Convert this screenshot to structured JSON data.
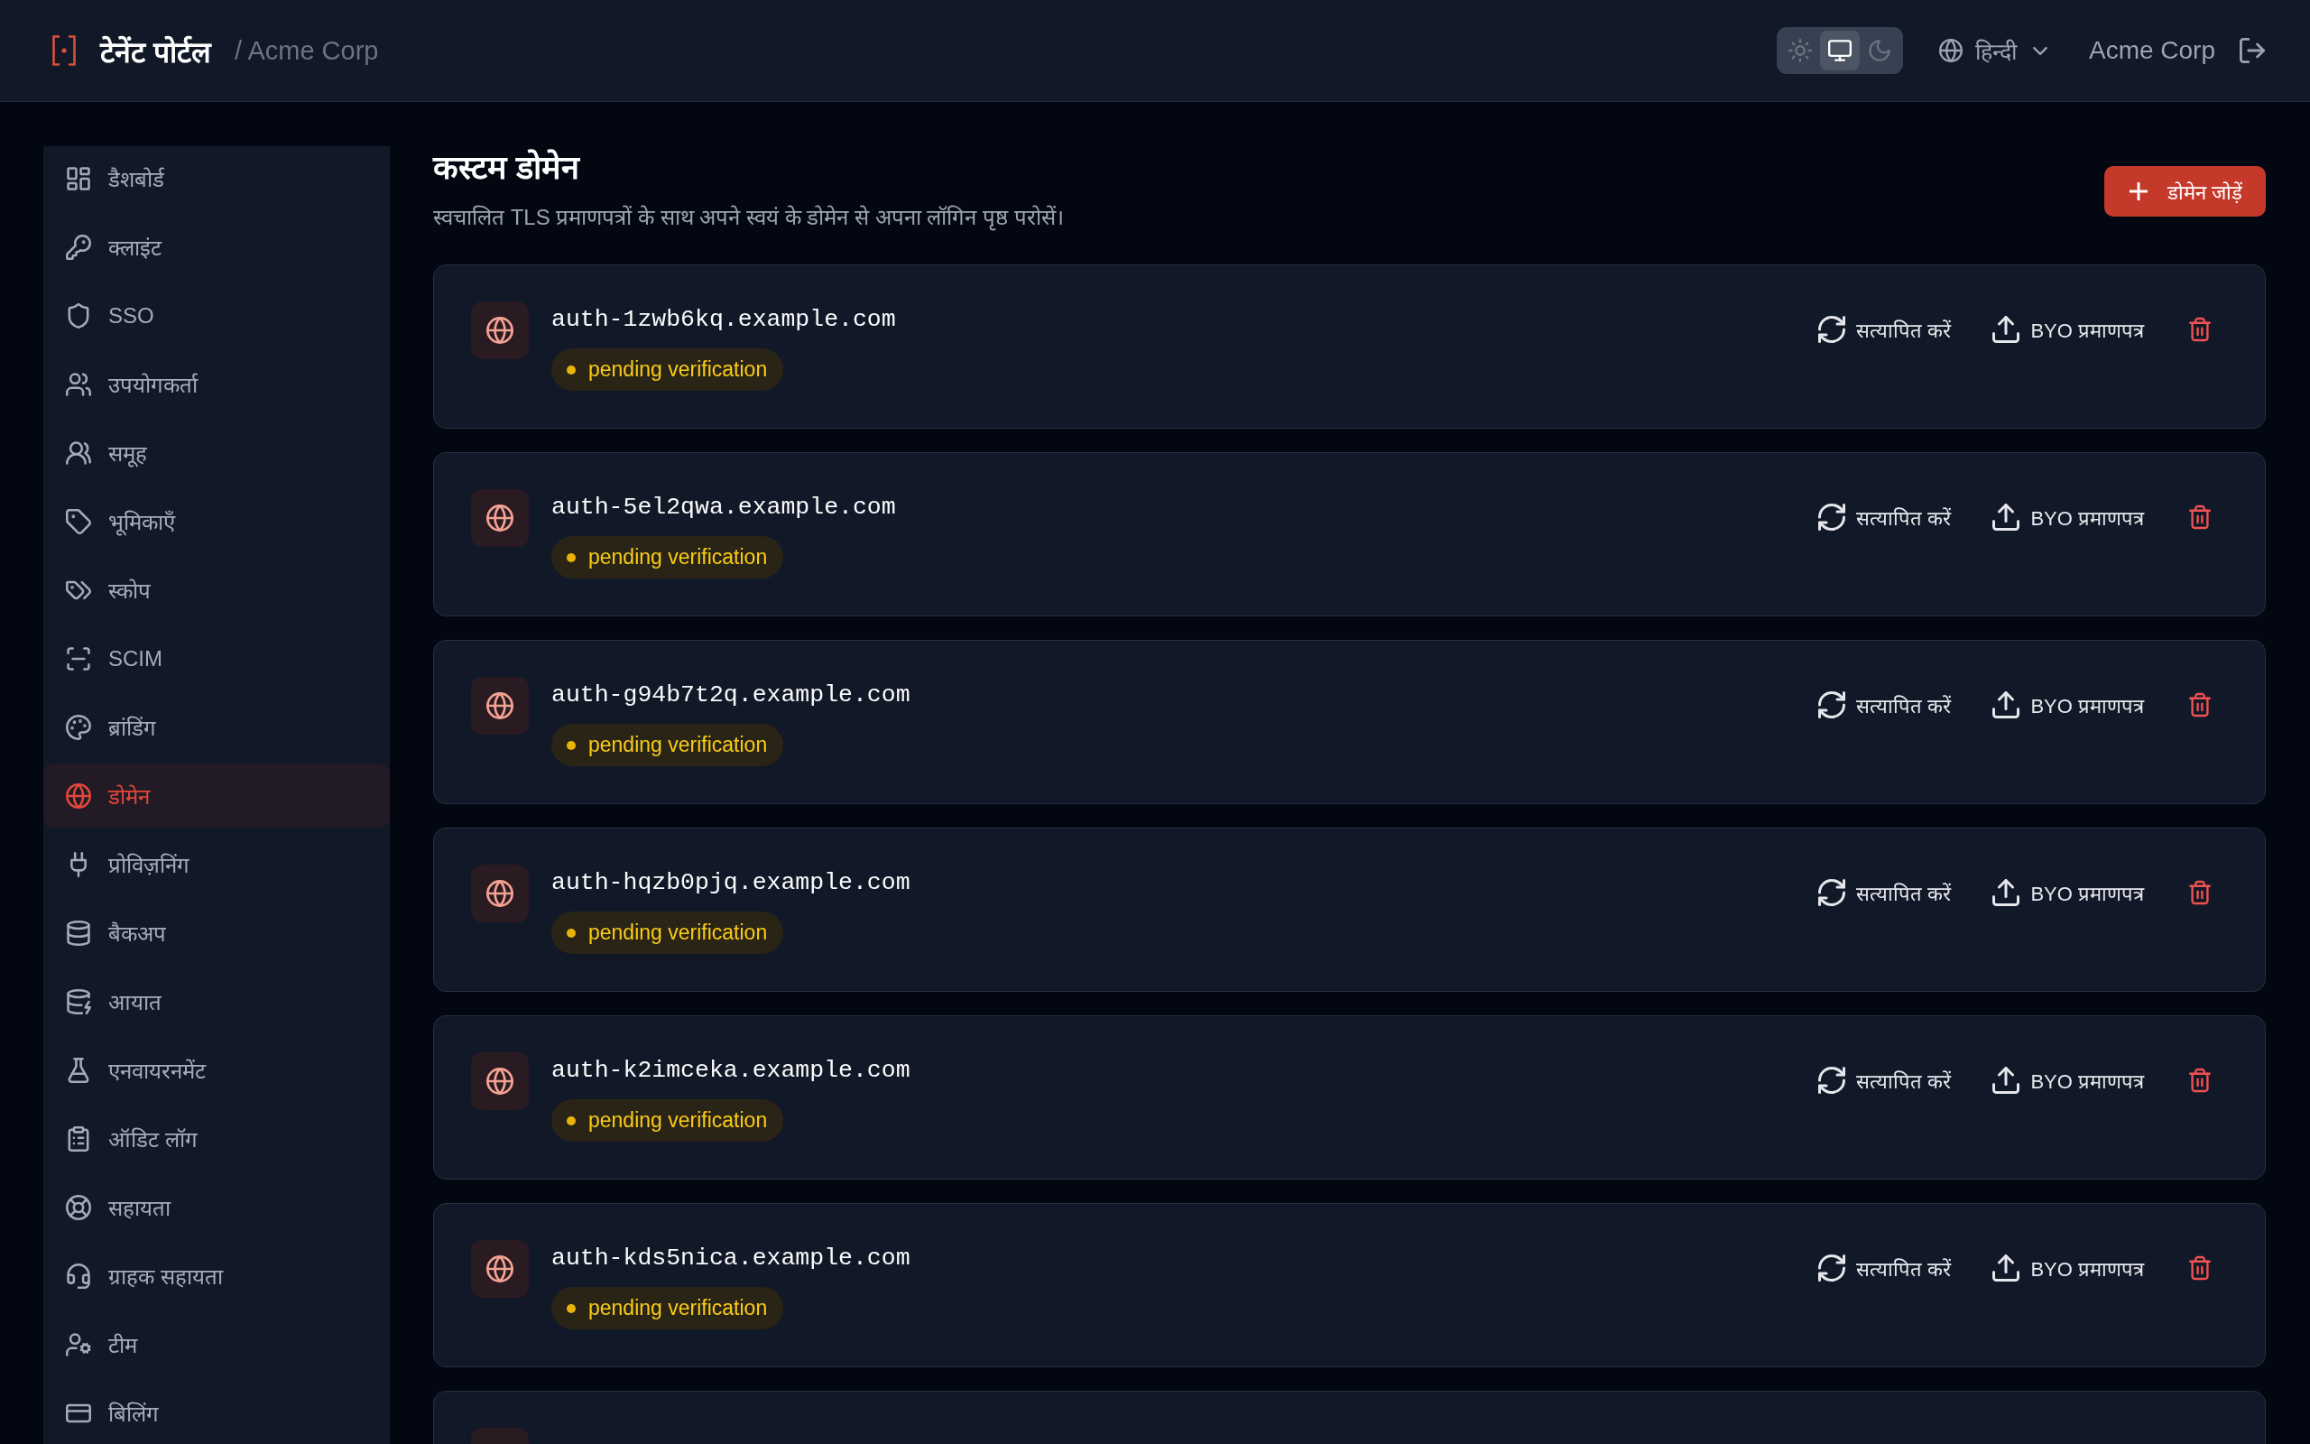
{
  "header": {
    "brand": "टेनेंट पोर्टल",
    "breadcrumb": "/ Acme Corp",
    "theme_options": [
      {
        "selected": false
      },
      {
        "selected": true
      },
      {
        "selected": false
      }
    ],
    "language": "हिन्दी",
    "account": "Acme Corp"
  },
  "sidebar": {
    "items": [
      {
        "label": "डैशबोर्ड",
        "selected": false
      },
      {
        "label": "क्लाइंट",
        "selected": false
      },
      {
        "label": "SSO",
        "selected": false
      },
      {
        "label": "उपयोगकर्ता",
        "selected": false
      },
      {
        "label": "समूह",
        "selected": false
      },
      {
        "label": "भूमिकाएँ",
        "selected": false
      },
      {
        "label": "स्कोप",
        "selected": false
      },
      {
        "label": "SCIM",
        "selected": false
      },
      {
        "label": "ब्रांडिंग",
        "selected": false
      },
      {
        "label": "डोमेन",
        "selected": true
      },
      {
        "label": "प्रोविज़निंग",
        "selected": false
      },
      {
        "label": "बैकअप",
        "selected": false
      },
      {
        "label": "आयात",
        "selected": false
      },
      {
        "label": "एनवायरनमेंट",
        "selected": false
      },
      {
        "label": "ऑडिट लॉग",
        "selected": false
      },
      {
        "label": "सहायता",
        "selected": false
      },
      {
        "label": "ग्राहक सहायता",
        "selected": false
      },
      {
        "label": "टीम",
        "selected": false
      },
      {
        "label": "बिलिंग",
        "selected": false
      }
    ]
  },
  "page": {
    "title": "कस्टम डोमेन",
    "subtitle": "स्वचालित TLS प्रमाणपत्रों के साथ अपने स्वयं के डोमेन से अपना लॉगिन पृष्ठ परोसें।",
    "add_button": "डोमेन जोड़ें"
  },
  "domains": [
    {
      "kind": "full",
      "domain": "auth-1zwb6kq.example.com",
      "status": "pending verification",
      "verify_button": "सत्यापित करें",
      "upload_button": "BYO प्रमाणपत्र"
    },
    {
      "kind": "full",
      "domain": "auth-5el2qwa.example.com",
      "status": "pending verification",
      "verify_button": "सत्यापित करें",
      "upload_button": "BYO प्रमाणपत्र"
    },
    {
      "kind": "full",
      "domain": "auth-g94b7t2q.example.com",
      "status": "pending verification",
      "verify_button": "सत्यापित करें",
      "upload_button": "BYO प्रमाणपत्र"
    },
    {
      "kind": "full",
      "domain": "auth-hqzb0pjq.example.com",
      "status": "pending verification",
      "verify_button": "सत्यापित करें",
      "upload_button": "BYO प्रमाणपत्र"
    },
    {
      "kind": "full",
      "domain": "auth-k2imceka.example.com",
      "status": "pending verification",
      "verify_button": "सत्यापित करें",
      "upload_button": "BYO प्रमाणपत्र"
    },
    {
      "kind": "full",
      "domain": "auth-kds5nica.example.com",
      "status": "pending verification",
      "verify_button": "सत्यापित करें",
      "upload_button": "BYO प्रमाणपत्र"
    },
    {
      "kind": "cut_off"
    }
  ]
}
